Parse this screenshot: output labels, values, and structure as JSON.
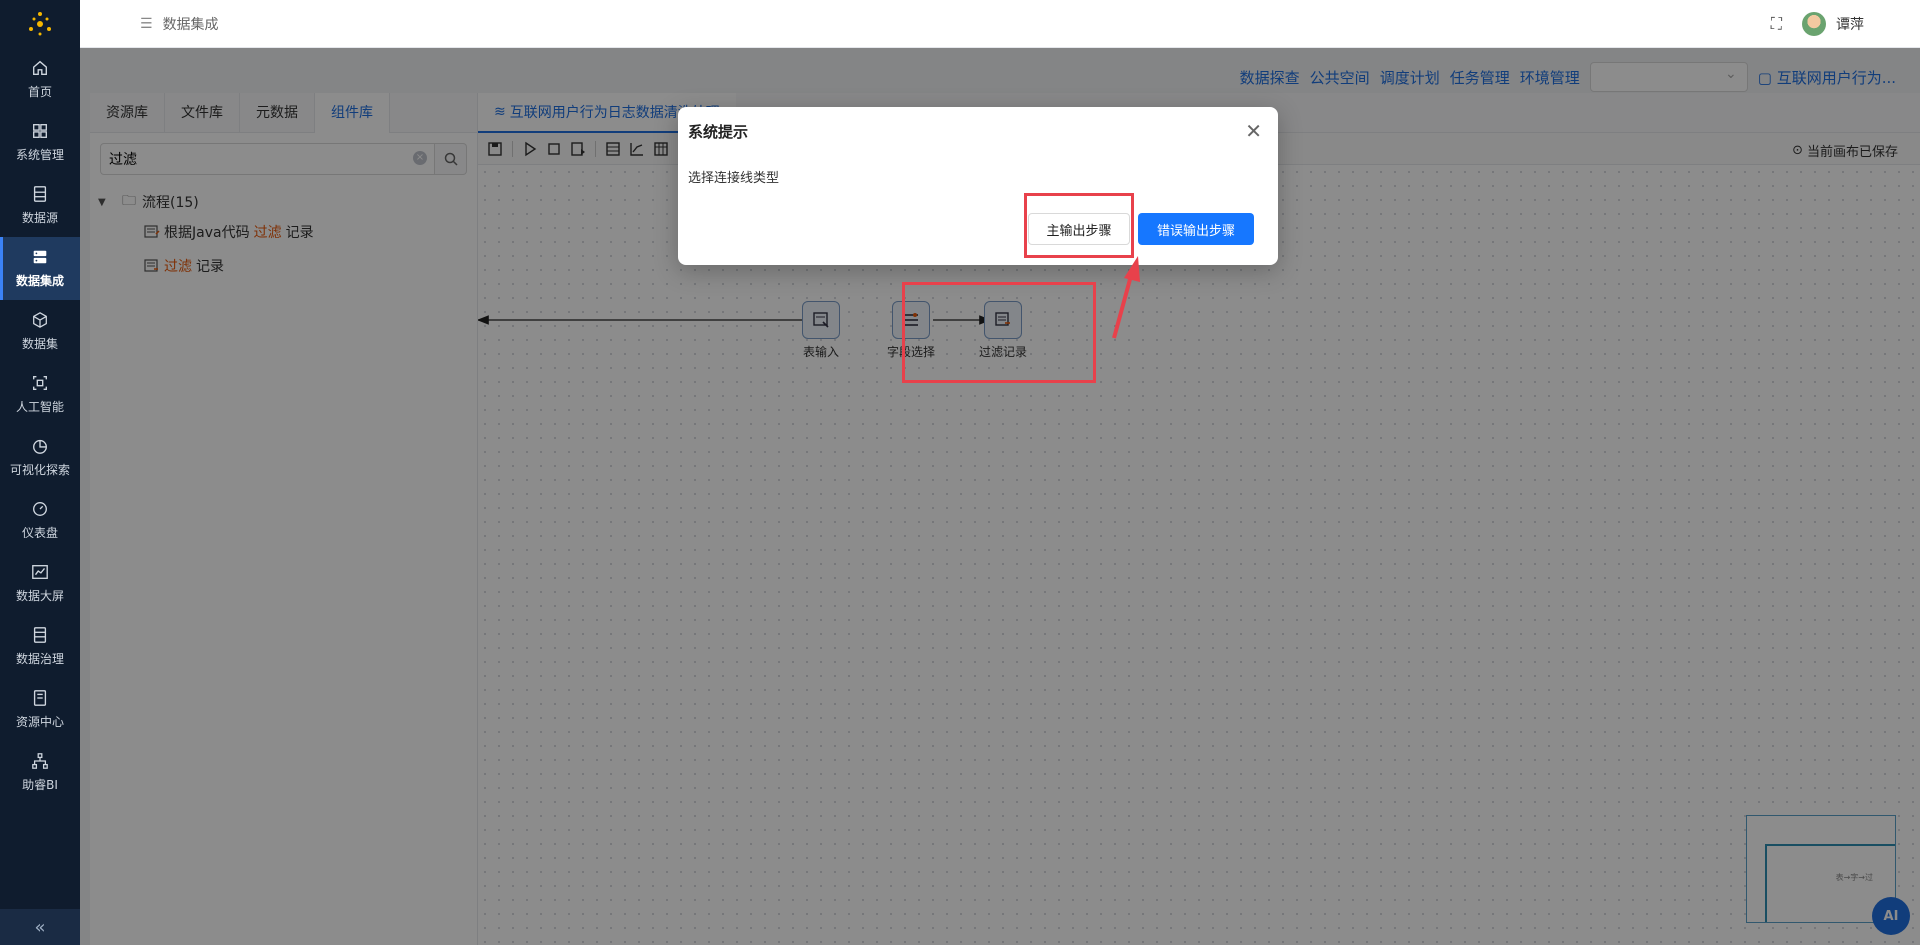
{
  "sidebar": {
    "items": [
      {
        "label": "首页",
        "icon": "home-icon"
      },
      {
        "label": "系统管理",
        "icon": "grid-icon"
      },
      {
        "label": "数据源",
        "icon": "database-icon"
      },
      {
        "label": "数据集成",
        "icon": "server-stack-icon",
        "active": true
      },
      {
        "label": "数据集",
        "icon": "cube-icon"
      },
      {
        "label": "人工智能",
        "icon": "scan-icon"
      },
      {
        "label": "可视化探索",
        "icon": "pie-chart-icon"
      },
      {
        "label": "仪表盘",
        "icon": "gauge-icon"
      },
      {
        "label": "数据大屏",
        "icon": "line-chart-icon"
      },
      {
        "label": "数据治理",
        "icon": "document-icon"
      },
      {
        "label": "资源中心",
        "icon": "archive-icon"
      },
      {
        "label": "助睿BI",
        "icon": "org-chart-icon"
      }
    ],
    "collapse": "«"
  },
  "topbar": {
    "breadcrumb": "数据集成",
    "username": "谭萍"
  },
  "links": [
    "数据探查",
    "公共空间",
    "调度计划",
    "任务管理",
    "环境管理"
  ],
  "project_link": "互联网用户行为...",
  "left": {
    "tabs": [
      "资源库",
      "文件库",
      "元数据",
      "组件库"
    ],
    "active_tab": "组件库",
    "search_value": "过滤",
    "tree": {
      "folder": "流程(15)",
      "items": [
        {
          "prefix": "根据Java代码",
          "hl": "过滤",
          "suffix": "记录"
        },
        {
          "prefix": "",
          "hl": "过滤",
          "suffix": "记录"
        }
      ]
    }
  },
  "canvas": {
    "file_tab": "互联网用户行为日志数据清洗处理",
    "saved": "当前画布已保存",
    "nodes": [
      {
        "label": "表输入"
      },
      {
        "label": "字段选择"
      },
      {
        "label": "过滤记录"
      }
    ],
    "minimap_text": "表→字→过",
    "ai": "AI"
  },
  "dialog": {
    "title": "系统提示",
    "message": "选择连接线类型",
    "btn_main": "主输出步骤",
    "btn_error": "错误输出步骤"
  },
  "colors": {
    "sidebar_bg": "#0f1c2e",
    "accent": "#1f6fe0",
    "primary_button": "#1677ff",
    "highlight": "#e8590c",
    "annotation": "#e8414b"
  }
}
